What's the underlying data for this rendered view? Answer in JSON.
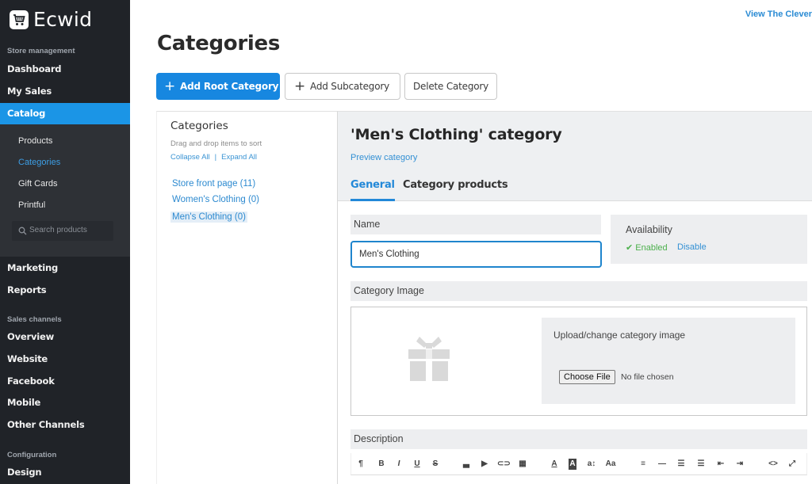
{
  "app": {
    "name": "Ecwid"
  },
  "top_link": "View The Clever",
  "sidebar": {
    "sections": {
      "store_management": "Store management",
      "sales_channels": "Sales channels",
      "configuration": "Configuration"
    },
    "items": {
      "dashboard": "Dashboard",
      "my_sales": "My Sales",
      "catalog": "Catalog",
      "marketing": "Marketing",
      "reports": "Reports",
      "overview": "Overview",
      "website": "Website",
      "facebook": "Facebook",
      "mobile": "Mobile",
      "other_channels": "Other Channels",
      "design": "Design"
    },
    "catalog_sub": {
      "products": "Products",
      "categories": "Categories",
      "gift_cards": "Gift Cards",
      "printful": "Printful"
    },
    "search_placeholder": "Search products",
    "active_item": "Catalog",
    "active_subitem": "Categories"
  },
  "page": {
    "title": "Categories",
    "buttons": {
      "add_root": "Add Root Category",
      "add_sub": "Add Subcategory",
      "delete": "Delete Category"
    }
  },
  "categories_panel": {
    "title": "Categories",
    "hint": "Drag and drop items to sort",
    "collapse_all": "Collapse All",
    "separator": "|",
    "expand_all": "Expand All",
    "items": [
      {
        "label": "Store front page (11)"
      },
      {
        "label": "Women's Clothing (0)"
      },
      {
        "label": "Men's Clothing (0)",
        "selected": true
      }
    ]
  },
  "editor": {
    "title": "'Men's Clothing' category",
    "preview_link": "Preview category",
    "tabs": [
      {
        "label": "General",
        "active": true
      },
      {
        "label": "Category products",
        "active": false
      }
    ],
    "name_label": "Name",
    "name_value": "Men's Clothing",
    "availability": {
      "title": "Availability",
      "status": "✔ Enabled",
      "action": "Disable",
      "status_color": "#4cb04c"
    },
    "image_label": "Category Image",
    "upload": {
      "title": "Upload/change category image",
      "choose_file": "Choose File",
      "no_file": "No file chosen"
    },
    "description_label": "Description",
    "toolbar": [
      {
        "icon": "paragraph-icon",
        "glyph": "¶"
      },
      {
        "icon": "bold-icon",
        "glyph": "B"
      },
      {
        "icon": "italic-icon",
        "glyph": "I"
      },
      {
        "icon": "underline-icon",
        "glyph": "U"
      },
      {
        "icon": "strikethrough-icon",
        "glyph": "S"
      },
      {
        "icon": "image-icon",
        "glyph": "▃"
      },
      {
        "icon": "video-icon",
        "glyph": "▶"
      },
      {
        "icon": "link-icon",
        "glyph": "⊂⊃"
      },
      {
        "icon": "table-icon",
        "glyph": "▦"
      },
      {
        "icon": "font-color-icon",
        "glyph": "A"
      },
      {
        "icon": "background-color-icon",
        "glyph": "A"
      },
      {
        "icon": "font-size-icon",
        "glyph": "a↕"
      },
      {
        "icon": "font-family-icon",
        "glyph": "Aa"
      },
      {
        "icon": "align-icon",
        "glyph": "≡"
      },
      {
        "icon": "horizontal-rule-icon",
        "glyph": "—"
      },
      {
        "icon": "unordered-list-icon",
        "glyph": "☰"
      },
      {
        "icon": "ordered-list-icon",
        "glyph": "☰"
      },
      {
        "icon": "outdent-icon",
        "glyph": "⇤"
      },
      {
        "icon": "indent-icon",
        "glyph": "⇥"
      },
      {
        "icon": "code-view-icon",
        "glyph": "<>"
      },
      {
        "icon": "fullscreen-icon",
        "glyph": "⤢"
      }
    ]
  },
  "colors": {
    "accent": "#1b95e6",
    "sidebar_bg": "#202328",
    "link": "#2d8ad0"
  }
}
